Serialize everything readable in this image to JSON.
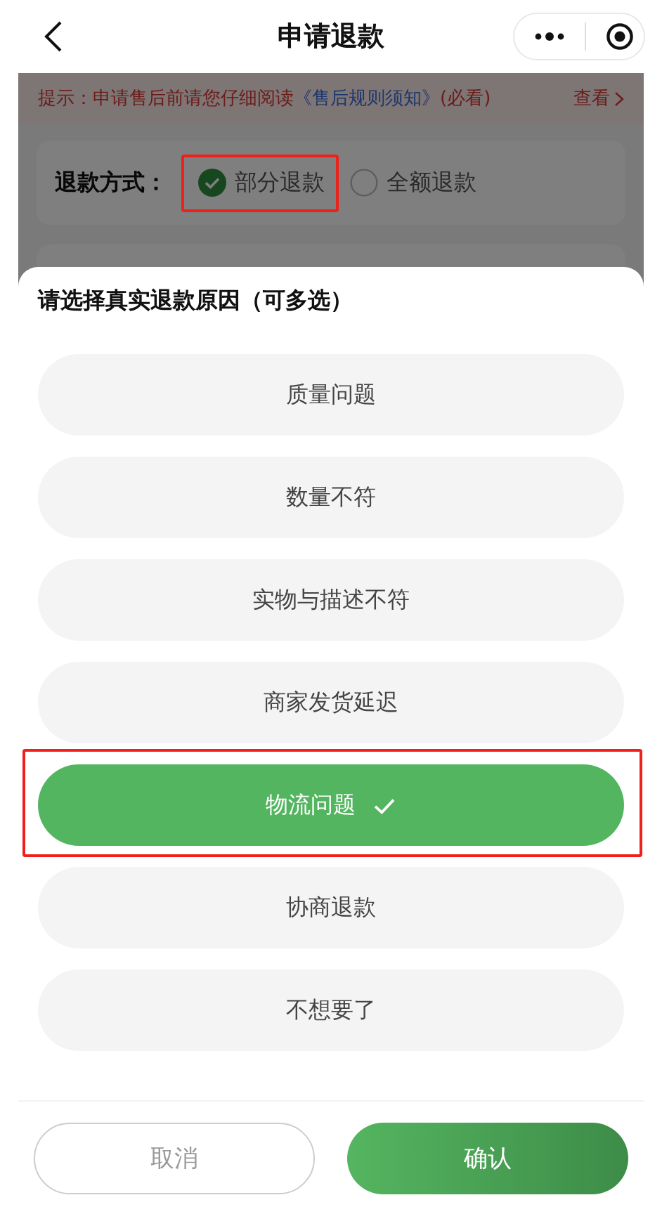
{
  "nav": {
    "title": "申请退款"
  },
  "notice": {
    "label": "提示：",
    "text": "申请售后前请您仔细阅读",
    "link": "《售后规则须知》",
    "suffix": "(必看)",
    "action": "查看"
  },
  "refund_method": {
    "label": "退款方式：",
    "options": [
      {
        "label": "部分退款",
        "selected": true,
        "highlighted": true
      },
      {
        "label": "全额退款",
        "selected": false,
        "highlighted": false
      }
    ]
  },
  "sheet": {
    "title": "请选择真实退款原因（可多选）",
    "reasons": [
      {
        "label": "质量问题",
        "selected": false,
        "highlighted": false
      },
      {
        "label": "数量不符",
        "selected": false,
        "highlighted": false
      },
      {
        "label": "实物与描述不符",
        "selected": false,
        "highlighted": false
      },
      {
        "label": "商家发货延迟",
        "selected": false,
        "highlighted": false
      },
      {
        "label": "物流问题",
        "selected": true,
        "highlighted": true
      },
      {
        "label": "协商退款",
        "selected": false,
        "highlighted": false
      },
      {
        "label": "不想要了",
        "selected": false,
        "highlighted": false
      }
    ],
    "buttons": [
      {
        "label": "取消",
        "kind": "cancel"
      },
      {
        "label": "确认",
        "kind": "confirm"
      }
    ]
  }
}
